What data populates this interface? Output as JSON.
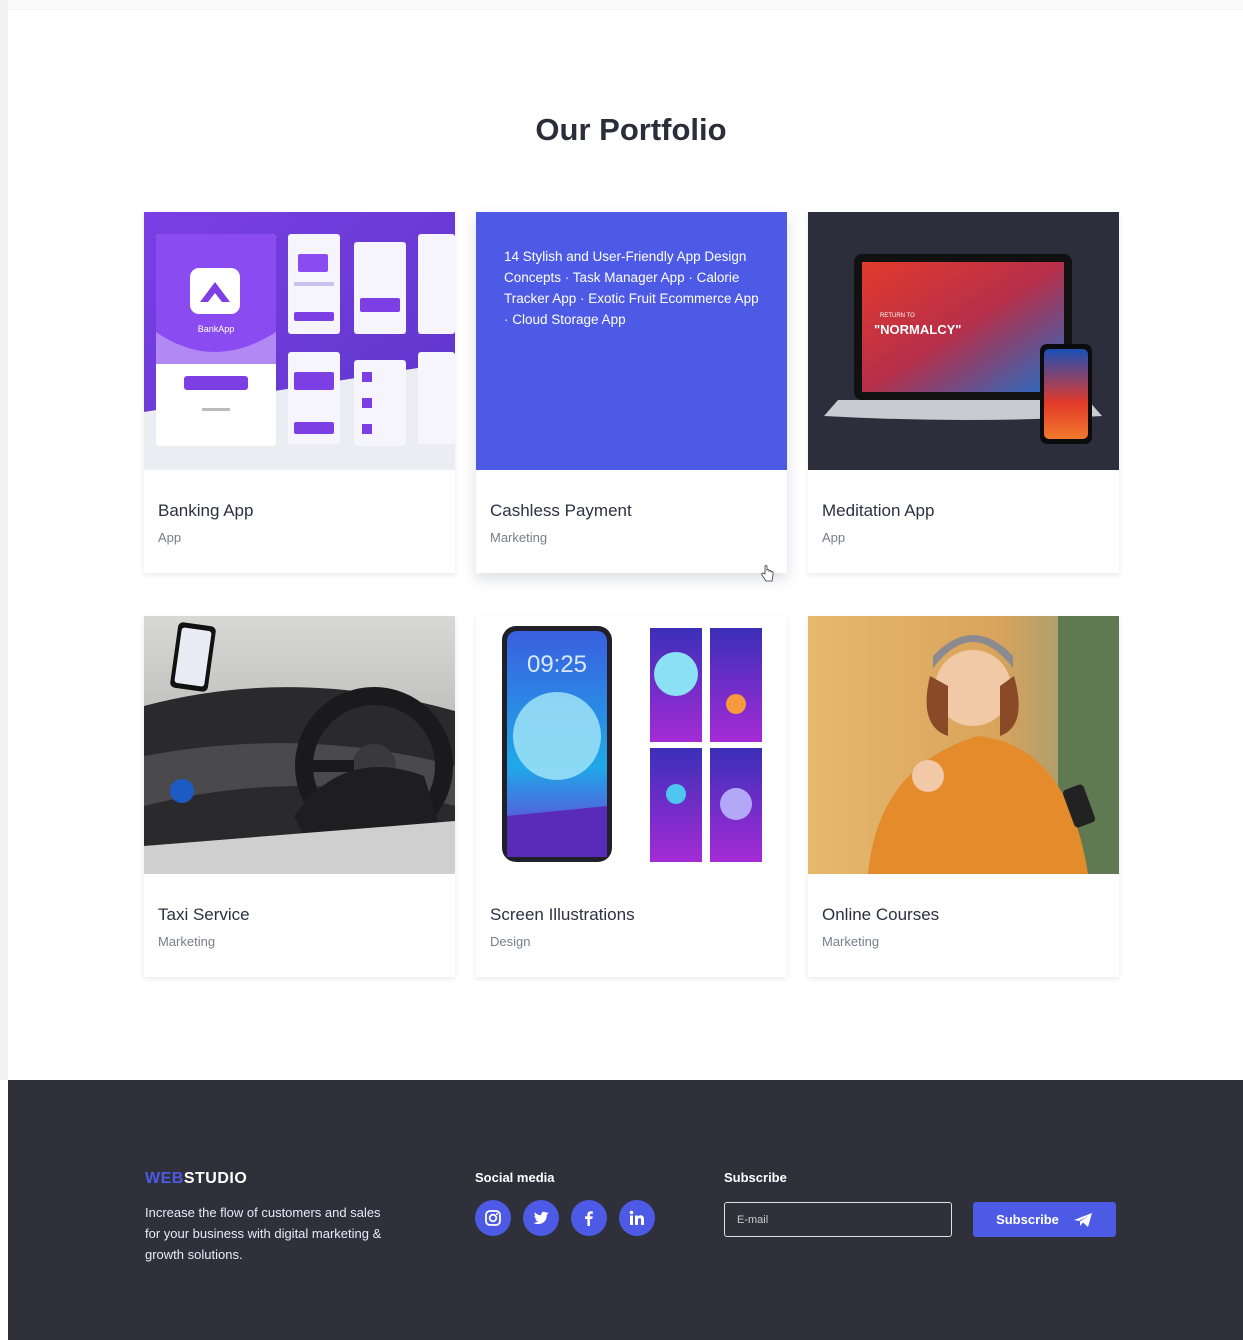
{
  "portfolio": {
    "title": "Our Portfolio",
    "items": [
      {
        "title": "Banking App",
        "category": "App",
        "image": "banking-app-mockups"
      },
      {
        "title": "Cashless Payment",
        "category": "Marketing",
        "overlay_text": "14 Stylish and User-Friendly App Design Concepts · Task Manager App · Calorie Tracker App · Exotic Fruit Ecommerce App · Cloud Storage App"
      },
      {
        "title": "Meditation App",
        "category": "App",
        "image": "laptop-phone-mockup",
        "image_text": "\"NORMALCY\""
      },
      {
        "title": "Taxi Service",
        "category": "Marketing",
        "image": "car-interior-photo"
      },
      {
        "title": "Screen Illustrations",
        "category": "Design",
        "image": "phone-screen-illustrations",
        "image_text": "09:25"
      },
      {
        "title": "Online Courses",
        "category": "Marketing",
        "image": "woman-with-phone-photo"
      }
    ]
  },
  "footer": {
    "logo_accent": "WEB",
    "logo_rest": "STUDIO",
    "description": "Increase the flow of customers and sales for your business with digital marketing & growth solutions.",
    "social_heading": "Social media",
    "social_links": [
      "instagram-icon",
      "twitter-icon",
      "facebook-icon",
      "linkedin-icon"
    ],
    "subscribe_heading": "Subscribe",
    "email_placeholder": "E-mail",
    "subscribe_label": "Subscribe"
  },
  "colors": {
    "accent": "#4d5ae5",
    "footer_bg": "#2f303a",
    "title_text": "#2a2d3a"
  }
}
